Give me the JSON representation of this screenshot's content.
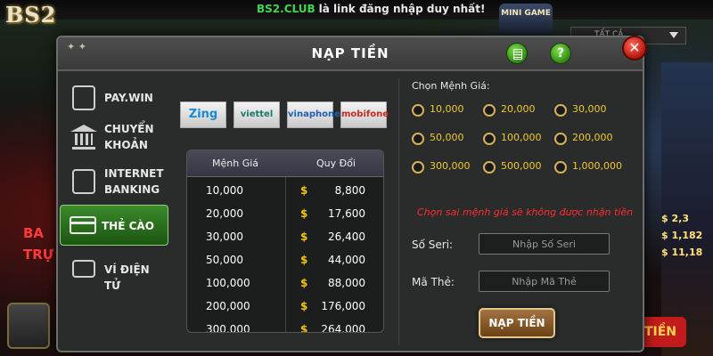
{
  "background": {
    "brand": "BS2",
    "notice_club": "BS2.CLUB",
    "notice_text": "là link đăng nhập duy nhất!",
    "minigame": "MINI GAME",
    "filter_label": "TẤT CẢ",
    "jackpot_values": [
      "$ 2,3",
      "$ 1,182",
      "$ 11,18"
    ],
    "left_sign": "BA TRỰ",
    "right_sign": "TIỀN",
    "colors": {
      "accent_green": "#3fd84c",
      "gold": "#f0c832",
      "warning_red": "#ff2d2d"
    }
  },
  "modal": {
    "title": "NẠP TIỀN",
    "header_icons": [
      "list-icon",
      "help-icon",
      "close-icon"
    ],
    "help_glyph": "?",
    "close_glyph": "✕",
    "sidebar": [
      {
        "id": "pay-win",
        "label": "PAY.WIN",
        "icon": "phone-icon",
        "active": false
      },
      {
        "id": "chuyen-khoan",
        "label_line1": "CHUYỂN",
        "label_line2": "KHOẢN",
        "icon": "bank-icon",
        "active": false
      },
      {
        "id": "internet-banking",
        "label_line1": "INTERNET",
        "label_line2": "BANKING",
        "icon": "mobile-bank-icon",
        "active": false
      },
      {
        "id": "the-cao",
        "label": "THẺ CÀO",
        "icon": "card-icon",
        "active": true
      },
      {
        "id": "vi-dien-tu",
        "label": "VÍ ĐIỆN TỬ",
        "icon": "wallet-icon",
        "active": false
      }
    ],
    "card_types": [
      {
        "id": "zing",
        "label": "Zing"
      },
      {
        "id": "viettel",
        "label": "viettel"
      },
      {
        "id": "vinaphone",
        "label": "vinaphone"
      },
      {
        "id": "mobifone",
        "label": "mobifone"
      }
    ],
    "table": {
      "headers": [
        "Mệnh Giá",
        "Quy Đổi"
      ],
      "currency_symbol": "$",
      "rows": [
        {
          "value": "10,000",
          "exchange": "8,800"
        },
        {
          "value": "20,000",
          "exchange": "17,600"
        },
        {
          "value": "30,000",
          "exchange": "26,400"
        },
        {
          "value": "50,000",
          "exchange": "44,000"
        },
        {
          "value": "100,000",
          "exchange": "88,000"
        },
        {
          "value": "200,000",
          "exchange": "176,000"
        },
        {
          "value": "300,000",
          "exchange": "264,000"
        }
      ]
    },
    "denomination_label": "Chọn Mệnh Giá:",
    "denominations": [
      "10,000",
      "20,000",
      "30,000",
      "50,000",
      "100,000",
      "200,000",
      "300,000",
      "500,000",
      "1,000,000"
    ],
    "warning": "Chọn sai mệnh giá sẽ không được nhận tiền",
    "serial_label": "Số Seri:",
    "serial_placeholder": "Nhập Số Seri",
    "code_label": "Mã Thẻ:",
    "code_placeholder": "Nhập Mã Thẻ",
    "submit_label": "NẠP TIỀN"
  }
}
